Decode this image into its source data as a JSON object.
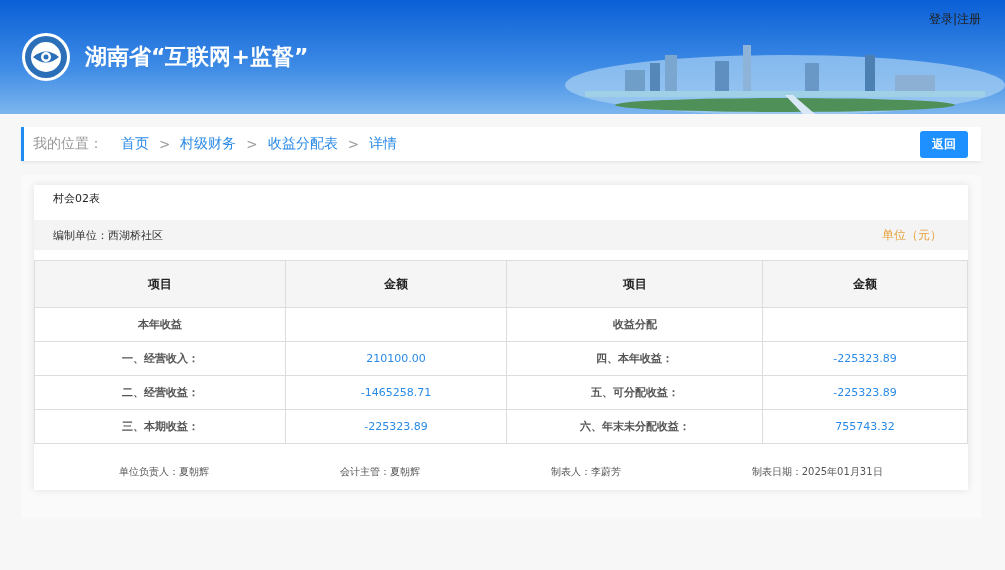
{
  "header": {
    "title": "湖南省“互联网+监督”",
    "auth_link": "登录|注册"
  },
  "breadcrumb": {
    "label": "我的位置：",
    "items": [
      "首页",
      "村级财务",
      "收益分配表",
      "详情"
    ],
    "separator": ">"
  },
  "back_button": "返回",
  "report": {
    "code": "村会02表",
    "unit_label": "编制单位：西湖桥社区",
    "currency": "单位（元）",
    "columns": [
      "项目",
      "金额",
      "项目",
      "金额"
    ],
    "rows": [
      {
        "cells": [
          "本年收益",
          "",
          "收益分配",
          ""
        ]
      },
      {
        "cells": [
          "一、经营收入：",
          "210100.00",
          "四、本年收益：",
          "-225323.89"
        ]
      },
      {
        "cells": [
          "二、经营收益：",
          "-1465258.71",
          "五、可分配收益：",
          "-225323.89"
        ]
      },
      {
        "cells": [
          "三、本期收益：",
          "-225323.89",
          "六、年末未分配收益：",
          "755743.32"
        ]
      }
    ],
    "signatures": [
      "单位负责人：夏朝辉",
      "会计主管：夏朝辉",
      "制表人：李蔚芳",
      "制表日期：2025年01月31日"
    ]
  }
}
